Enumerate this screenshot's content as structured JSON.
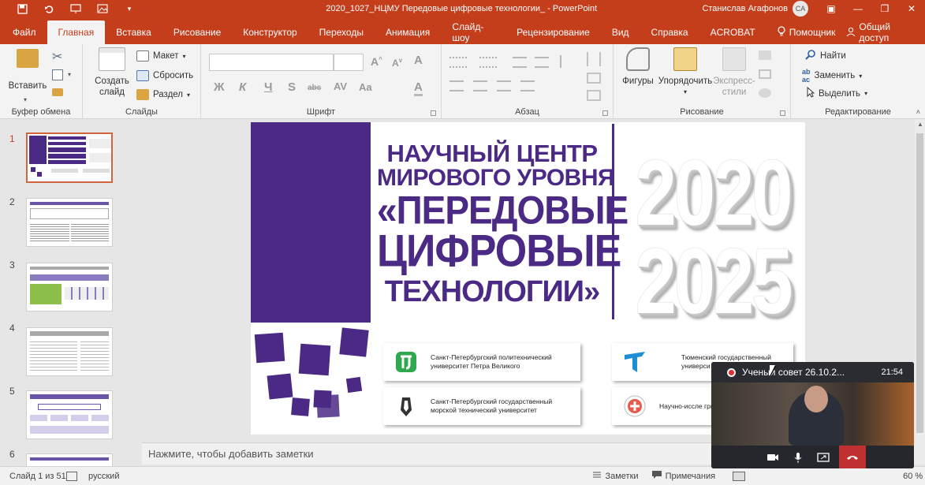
{
  "titlebar": {
    "doc_title": "2020_1027_НЦМУ Передовые цифровые технологии_  -  PowerPoint",
    "user_name": "Станислав Агафонов",
    "user_initials": "CA"
  },
  "tabs": [
    "Файл",
    "Главная",
    "Вставка",
    "Рисование",
    "Конструктор",
    "Переходы",
    "Анимация",
    "Слайд-шоу",
    "Рецензирование",
    "Вид",
    "Справка",
    "ACROBAT"
  ],
  "tab_active": "Главная",
  "tab_helper": "Помощник",
  "share_label": "Общий доступ",
  "ribbon": {
    "clipboard": {
      "paste": "Вставить",
      "group": "Буфер обмена"
    },
    "slides": {
      "new_slide": "Создать",
      "new_slide2": "слайд",
      "layout": "Макет",
      "reset": "Сбросить",
      "section": "Раздел",
      "group": "Слайды"
    },
    "font": {
      "bold": "Ж",
      "italic": "К",
      "underline": "Ч",
      "shadow": "S",
      "strike": "abc",
      "spacing": "AV",
      "case": "Aa",
      "group": "Шрифт"
    },
    "paragraph": {
      "group": "Абзац"
    },
    "drawing": {
      "shapes": "Фигуры",
      "arrange": "Упорядочить",
      "quick_styles": "Экспресс-",
      "quick_styles2": "стили",
      "group": "Рисование"
    },
    "editing": {
      "find": "Найти",
      "replace": "Заменить",
      "select": "Выделить",
      "group": "Редактирование"
    }
  },
  "thumbnails": [
    "1",
    "2",
    "3",
    "4",
    "5",
    "6"
  ],
  "slide": {
    "headline": [
      "НАУЧНЫЙ ЦЕНТР",
      "МИРОВОГО УРОВНЯ",
      "«ПЕРЕДОВЫЕ",
      "ЦИФРОВЫЕ",
      "ТЕХНОЛОГИИ»"
    ],
    "year_start": "2020",
    "year_end": "2025",
    "orgs": [
      {
        "name": "Санкт-Петербургский политехнический университет Петра Великого"
      },
      {
        "name": "Санкт-Петербургский государственный морской технический университет"
      },
      {
        "name": "Тюменский государственный универси"
      },
      {
        "name": "Научно-иссле грппа имени"
      }
    ]
  },
  "notes_placeholder": "Нажмите, чтобы добавить заметки",
  "status": {
    "slide_counter": "Слайд 1 из 51",
    "language": "русский",
    "notes_btn": "Заметки",
    "comments_btn": "Примечания",
    "zoom": "60 %"
  },
  "call": {
    "title": "Ученый совет 26.10.2...",
    "time": "21:54"
  },
  "colors": {
    "accent": "#c43e1c",
    "slide_purple": "#4b2a86",
    "hangup": "#c03030"
  }
}
